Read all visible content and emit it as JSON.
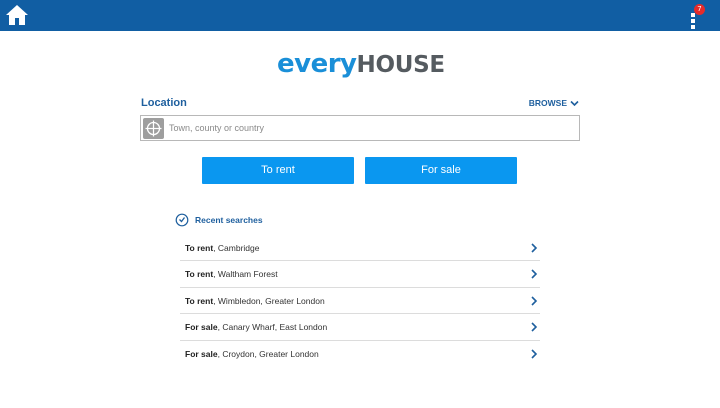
{
  "header": {
    "notification_count": "7",
    "accent_color": "#115ea3",
    "home_icon": "home-icon",
    "menu_icon": "menu-icon"
  },
  "logo": {
    "part1": "every",
    "part2": "HOUSE"
  },
  "search": {
    "label": "Location",
    "browse_label": "BROWSE",
    "placeholder": "Town, county or country",
    "value": "",
    "locate_icon": "locate-icon"
  },
  "actions": {
    "rent_label": "To rent",
    "sale_label": "For sale",
    "button_color": "#0a97f0"
  },
  "recent": {
    "title": "Recent searches",
    "items": [
      {
        "type": "To rent",
        "place": ", Cambridge"
      },
      {
        "type": "To rent",
        "place": ", Waltham Forest"
      },
      {
        "type": "To rent",
        "place": ", Wimbledon, Greater London"
      },
      {
        "type": "For sale",
        "place": ", Canary Wharf, East London"
      },
      {
        "type": "For sale",
        "place": ", Croydon, Greater London"
      }
    ]
  }
}
